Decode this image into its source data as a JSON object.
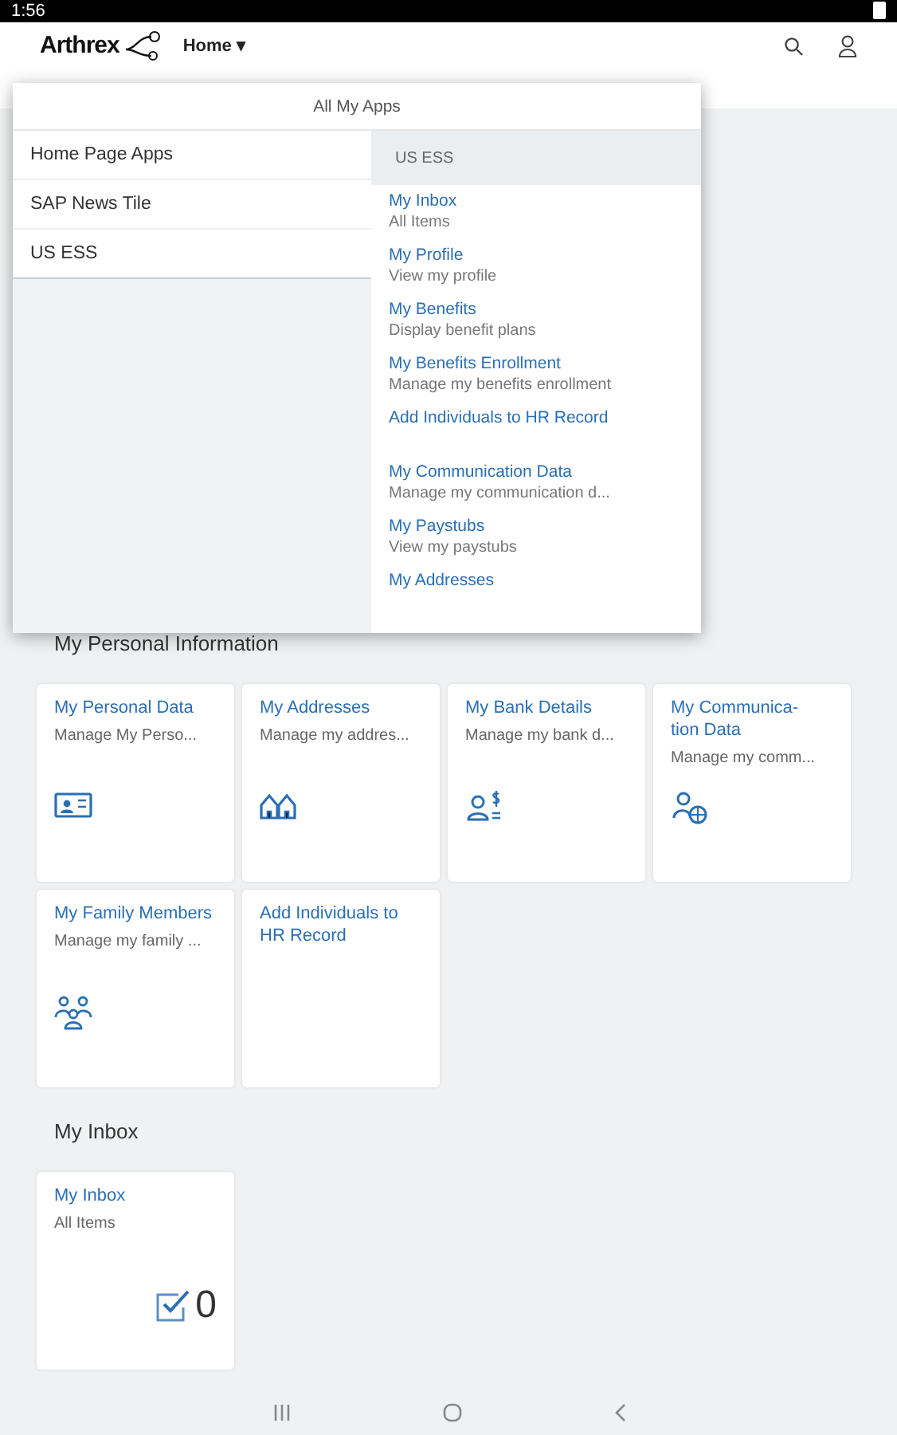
{
  "status_bar": {
    "time": "1:56"
  },
  "header": {
    "logo": "Arthrex",
    "menu_label": "Home ▾"
  },
  "popover": {
    "title": "All My Apps",
    "groups": [
      {
        "label": "Home Page Apps",
        "selected": false
      },
      {
        "label": "SAP News Tile",
        "selected": false
      },
      {
        "label": "US ESS",
        "selected": true
      }
    ],
    "panel_title": "US ESS",
    "apps": [
      {
        "title": "My Inbox",
        "subtitle": "All Items"
      },
      {
        "title": "My Profile",
        "subtitle": "View my profile"
      },
      {
        "title": "My Benefits",
        "subtitle": "Display benefit plans"
      },
      {
        "title": "My Benefits Enrollment",
        "subtitle": "Manage my benefits enrollment"
      },
      {
        "title": "Add Individuals to HR Record"
      },
      {
        "title": "My Communication Data",
        "subtitle": "Manage my communication d..."
      },
      {
        "title": "My Paystubs",
        "subtitle": "View my paystubs"
      },
      {
        "title": "My Addresses"
      }
    ]
  },
  "sections": [
    {
      "title": "My Personal Information",
      "tiles": [
        {
          "title": "My Personal Data",
          "subtitle": "Manage My Perso...",
          "kind": "id-card"
        },
        {
          "title": "My Addresses",
          "subtitle": "Manage my addres...",
          "kind": "houses"
        },
        {
          "title": "My Bank Details",
          "subtitle": "Manage my bank d...",
          "kind": "person-money"
        },
        {
          "title": "My Communica-\ntion Data",
          "subtitle": "Manage my comm...",
          "kind": "person-globe"
        },
        {
          "title": "My Family Members",
          "subtitle": "Manage my family ...",
          "kind": "family"
        },
        {
          "title": "Add Individuals to HR Record"
        }
      ]
    },
    {
      "title": "My Inbox",
      "tiles": [
        {
          "title": "My Inbox",
          "subtitle": "All Items",
          "kind": "checkbox",
          "count": "0"
        }
      ]
    }
  ]
}
